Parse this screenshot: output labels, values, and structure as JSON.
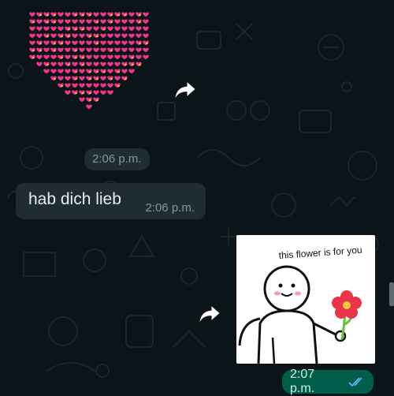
{
  "chat": {
    "messages": [
      {
        "type": "sticker-heart",
        "time": "2:06 p.m.",
        "sender": "contact"
      },
      {
        "type": "text",
        "text": "hab dich lieb",
        "time": "2:06 p.m.",
        "sender": "contact"
      },
      {
        "type": "sticker-image",
        "caption": "this flower is for you",
        "time": "2:07 p.m.",
        "sender": "me",
        "status_icon": "double-check-icon"
      }
    ]
  },
  "colors": {
    "background": "#0b1418",
    "incoming_bubble": "#1f2c33",
    "outgoing_bubble": "#005c4b",
    "timestamp": "#8696a0",
    "read_ticks": "#53bdeb",
    "heart_pink": "#f0358c"
  },
  "icons": {
    "forward": "forward-icon",
    "read_status": "double-check-icon"
  }
}
